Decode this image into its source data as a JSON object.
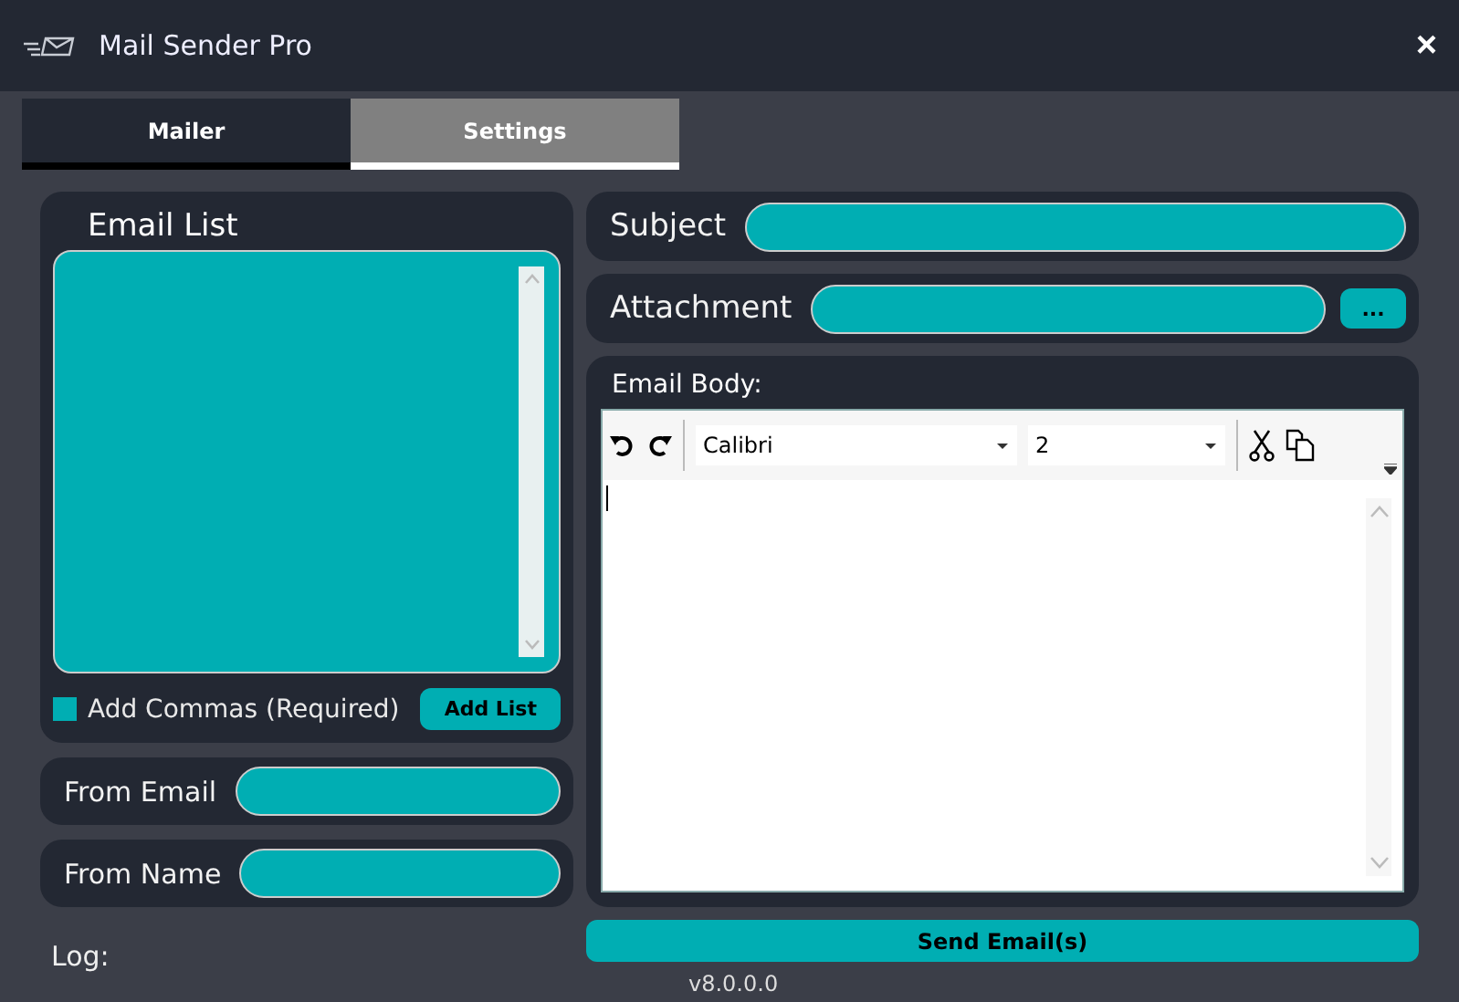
{
  "window": {
    "title": "Mail Sender Pro",
    "close": "×"
  },
  "tabs": [
    {
      "label": "Mailer",
      "selected": true
    },
    {
      "label": "Settings",
      "selected": false
    }
  ],
  "email_list": {
    "title": "Email List",
    "add_commas": {
      "label": "Add Commas (Required)",
      "checked": true
    },
    "add_button": "Add List"
  },
  "from_email": {
    "label": "From Email"
  },
  "from_name": {
    "label": "From Name"
  },
  "log": {
    "label": "Log:"
  },
  "subject": {
    "label": "Subject"
  },
  "attachment": {
    "label": "Attachment",
    "browse_button": "..."
  },
  "email_body": {
    "label": "Email Body:",
    "font": "Calibri",
    "size": "2"
  },
  "send_button": "Send Email(s)",
  "version": "v8.0.0.0"
}
